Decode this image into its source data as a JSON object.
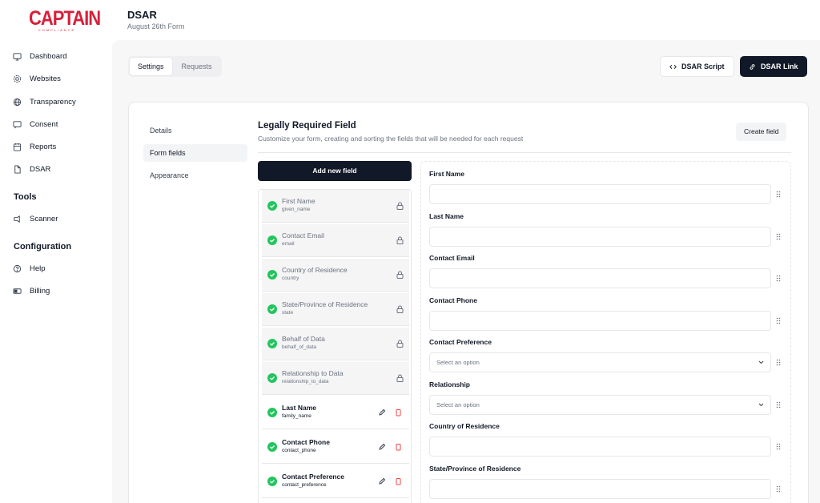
{
  "brand": {
    "name": "CAPTAIN",
    "tagline": "COMPLIANCE",
    "color": "#d81f3a"
  },
  "sidebar": {
    "items": [
      {
        "label": "Dashboard",
        "icon": "monitor-icon"
      },
      {
        "label": "Websites",
        "icon": "gear-icon"
      },
      {
        "label": "Transparency",
        "icon": "globe-icon"
      },
      {
        "label": "Consent",
        "icon": "message-icon"
      },
      {
        "label": "Reports",
        "icon": "calendar-icon"
      },
      {
        "label": "DSAR",
        "icon": "file-icon"
      }
    ],
    "tools_heading": "Tools",
    "tools": [
      {
        "label": "Scanner",
        "icon": "scanner-icon"
      }
    ],
    "config_heading": "Configuration",
    "config": [
      {
        "label": "Help",
        "icon": "help-icon"
      },
      {
        "label": "Billing",
        "icon": "billing-icon"
      }
    ]
  },
  "header": {
    "title": "DSAR",
    "subtitle": "August 26th Form"
  },
  "tabs": [
    {
      "label": "Settings",
      "active": true
    },
    {
      "label": "Requests",
      "active": false
    }
  ],
  "actions": {
    "script_label": "DSAR Script",
    "link_label": "DSAR Link"
  },
  "subnav": [
    {
      "label": "Details",
      "active": false
    },
    {
      "label": "Form fields",
      "active": true
    },
    {
      "label": "Appearance",
      "active": false
    }
  ],
  "section": {
    "title": "Legally Required Field",
    "description": "Customize your form, creating and sorting the fields that will be needed for each request",
    "create_label": "Create field",
    "add_label": "Add new field"
  },
  "fields": [
    {
      "name": "First Name",
      "key": "given_name",
      "locked": true
    },
    {
      "name": "Contact Email",
      "key": "email",
      "locked": true
    },
    {
      "name": "Country of Residence",
      "key": "country",
      "locked": true
    },
    {
      "name": "State/Province of Residence",
      "key": "state",
      "locked": true
    },
    {
      "name": "Behalf of Data",
      "key": "behalf_of_data",
      "locked": true
    },
    {
      "name": "Relationship to Data",
      "key": "relationship_to_data",
      "locked": true
    },
    {
      "name": "Last Name",
      "key": "family_name",
      "locked": false
    },
    {
      "name": "Contact Phone",
      "key": "contact_phone",
      "locked": false
    },
    {
      "name": "Contact Preference",
      "key": "contact_preference",
      "locked": false
    }
  ],
  "preview": {
    "fields": [
      {
        "label": "First Name",
        "type": "text"
      },
      {
        "label": "Last Name",
        "type": "text"
      },
      {
        "label": "Contact Email",
        "type": "text"
      },
      {
        "label": "Contact Phone",
        "type": "text"
      },
      {
        "label": "Contact Preference",
        "type": "select",
        "placeholder": "Select an option"
      },
      {
        "label": "Relationship",
        "type": "select",
        "placeholder": "Select an option"
      },
      {
        "label": "Country of Residence",
        "type": "text"
      },
      {
        "label": "State/Province of Residence",
        "type": "text"
      }
    ]
  }
}
